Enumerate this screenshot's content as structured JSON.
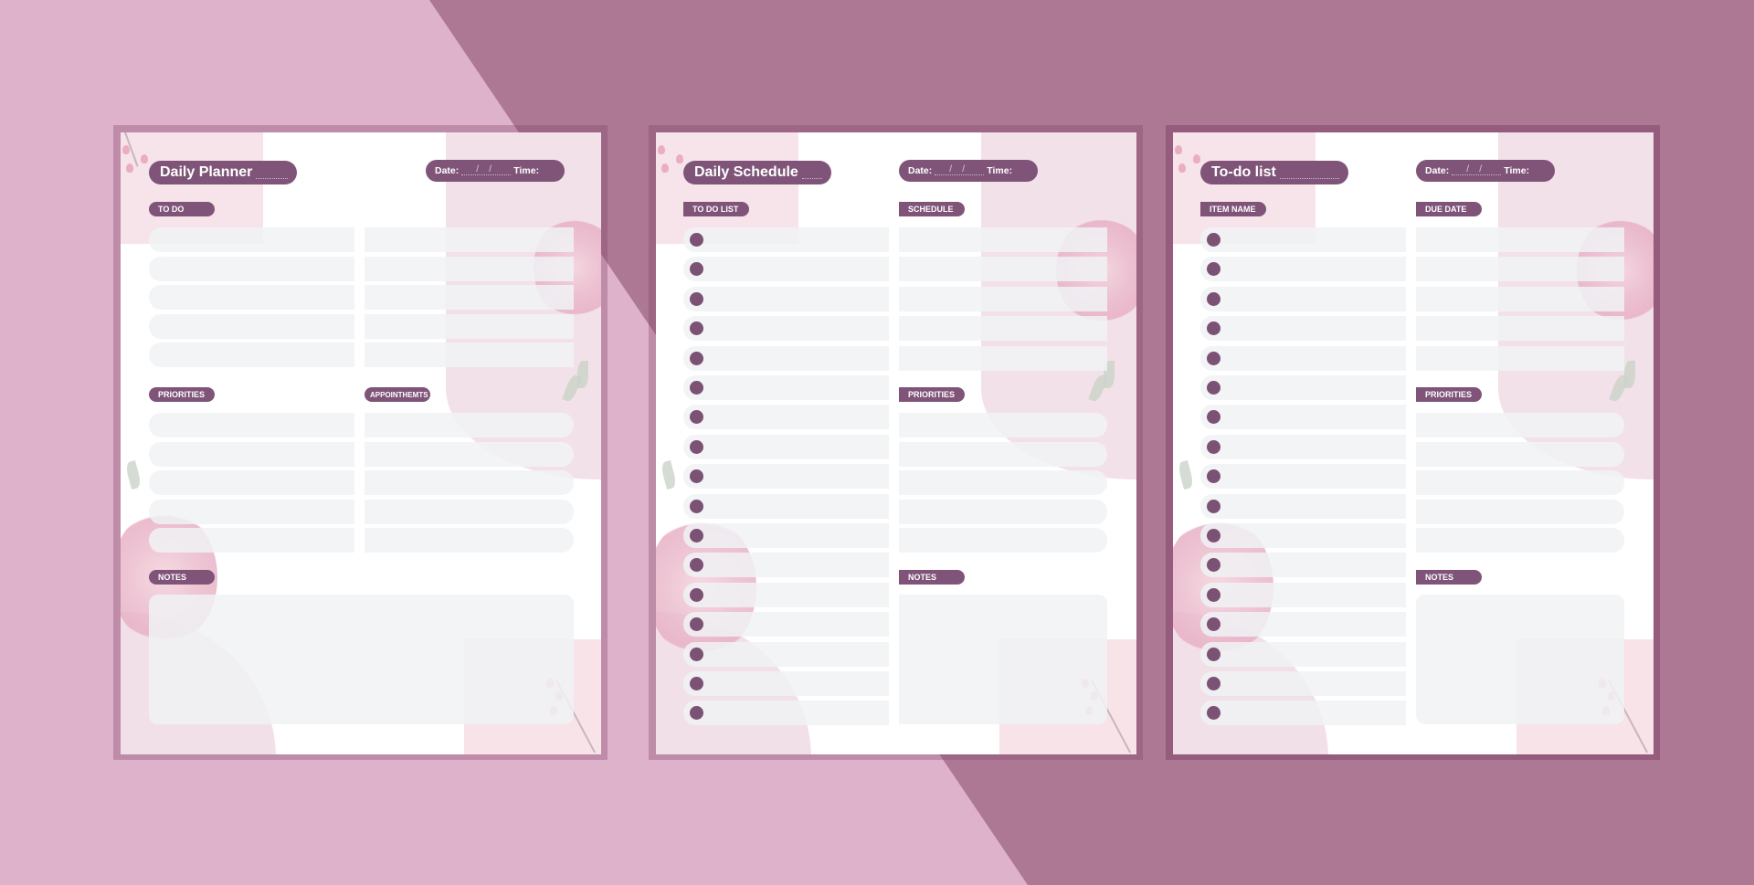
{
  "colors": {
    "background_light": "#dfb2cb",
    "background_dark": "#ad7894",
    "accent": "#7f5478",
    "row_fill": "#f1f2f4",
    "sheet": "#ffffff"
  },
  "panels": [
    {
      "title": "Daily Planner",
      "date_label": "Date:",
      "date_separator": "/",
      "time_label": "Time:",
      "sections": {
        "left_top": "TO DO",
        "right_top": "",
        "left_mid": "PRIORITIES",
        "right_mid": "APPOINTHEMTS",
        "notes": "NOTES"
      }
    },
    {
      "title": "Daily Schedule",
      "date_label": "Date:",
      "date_separator": "/",
      "time_label": "Time:",
      "sections": {
        "left_top": "TO DO LIST",
        "right_top": "SCHEDULE",
        "right_mid": "PRIORITIES",
        "notes": "NOTES"
      }
    },
    {
      "title": "To-do list",
      "date_label": "Date:",
      "date_separator": "/",
      "time_label": "Time:",
      "sections": {
        "left_top": "ITEM NAME",
        "right_top": "DUE DATE",
        "right_mid": "PRIORITIES",
        "notes": "NOTES"
      }
    }
  ],
  "icons": {
    "bullet": "filled-circle",
    "decoration_rose": "rose-illustration",
    "decoration_buds": "flower-buds-sprig"
  }
}
